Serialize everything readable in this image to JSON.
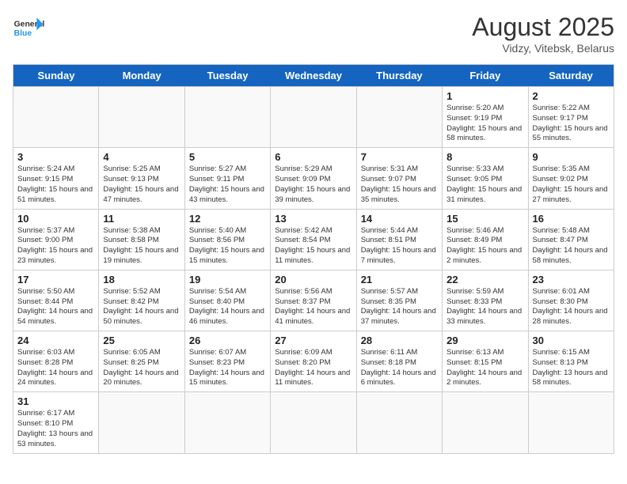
{
  "header": {
    "logo_line1": "General",
    "logo_line2": "Blue",
    "title": "August 2025",
    "subtitle": "Vidzy, Vitebsk, Belarus"
  },
  "days_of_week": [
    "Sunday",
    "Monday",
    "Tuesday",
    "Wednesday",
    "Thursday",
    "Friday",
    "Saturday"
  ],
  "weeks": [
    [
      {
        "date": "",
        "info": ""
      },
      {
        "date": "",
        "info": ""
      },
      {
        "date": "",
        "info": ""
      },
      {
        "date": "",
        "info": ""
      },
      {
        "date": "",
        "info": ""
      },
      {
        "date": "1",
        "info": "Sunrise: 5:20 AM\nSunset: 9:19 PM\nDaylight: 15 hours and 58 minutes."
      },
      {
        "date": "2",
        "info": "Sunrise: 5:22 AM\nSunset: 9:17 PM\nDaylight: 15 hours and 55 minutes."
      }
    ],
    [
      {
        "date": "3",
        "info": "Sunrise: 5:24 AM\nSunset: 9:15 PM\nDaylight: 15 hours and 51 minutes."
      },
      {
        "date": "4",
        "info": "Sunrise: 5:25 AM\nSunset: 9:13 PM\nDaylight: 15 hours and 47 minutes."
      },
      {
        "date": "5",
        "info": "Sunrise: 5:27 AM\nSunset: 9:11 PM\nDaylight: 15 hours and 43 minutes."
      },
      {
        "date": "6",
        "info": "Sunrise: 5:29 AM\nSunset: 9:09 PM\nDaylight: 15 hours and 39 minutes."
      },
      {
        "date": "7",
        "info": "Sunrise: 5:31 AM\nSunset: 9:07 PM\nDaylight: 15 hours and 35 minutes."
      },
      {
        "date": "8",
        "info": "Sunrise: 5:33 AM\nSunset: 9:05 PM\nDaylight: 15 hours and 31 minutes."
      },
      {
        "date": "9",
        "info": "Sunrise: 5:35 AM\nSunset: 9:02 PM\nDaylight: 15 hours and 27 minutes."
      }
    ],
    [
      {
        "date": "10",
        "info": "Sunrise: 5:37 AM\nSunset: 9:00 PM\nDaylight: 15 hours and 23 minutes."
      },
      {
        "date": "11",
        "info": "Sunrise: 5:38 AM\nSunset: 8:58 PM\nDaylight: 15 hours and 19 minutes."
      },
      {
        "date": "12",
        "info": "Sunrise: 5:40 AM\nSunset: 8:56 PM\nDaylight: 15 hours and 15 minutes."
      },
      {
        "date": "13",
        "info": "Sunrise: 5:42 AM\nSunset: 8:54 PM\nDaylight: 15 hours and 11 minutes."
      },
      {
        "date": "14",
        "info": "Sunrise: 5:44 AM\nSunset: 8:51 PM\nDaylight: 15 hours and 7 minutes."
      },
      {
        "date": "15",
        "info": "Sunrise: 5:46 AM\nSunset: 8:49 PM\nDaylight: 15 hours and 2 minutes."
      },
      {
        "date": "16",
        "info": "Sunrise: 5:48 AM\nSunset: 8:47 PM\nDaylight: 14 hours and 58 minutes."
      }
    ],
    [
      {
        "date": "17",
        "info": "Sunrise: 5:50 AM\nSunset: 8:44 PM\nDaylight: 14 hours and 54 minutes."
      },
      {
        "date": "18",
        "info": "Sunrise: 5:52 AM\nSunset: 8:42 PM\nDaylight: 14 hours and 50 minutes."
      },
      {
        "date": "19",
        "info": "Sunrise: 5:54 AM\nSunset: 8:40 PM\nDaylight: 14 hours and 46 minutes."
      },
      {
        "date": "20",
        "info": "Sunrise: 5:56 AM\nSunset: 8:37 PM\nDaylight: 14 hours and 41 minutes."
      },
      {
        "date": "21",
        "info": "Sunrise: 5:57 AM\nSunset: 8:35 PM\nDaylight: 14 hours and 37 minutes."
      },
      {
        "date": "22",
        "info": "Sunrise: 5:59 AM\nSunset: 8:33 PM\nDaylight: 14 hours and 33 minutes."
      },
      {
        "date": "23",
        "info": "Sunrise: 6:01 AM\nSunset: 8:30 PM\nDaylight: 14 hours and 28 minutes."
      }
    ],
    [
      {
        "date": "24",
        "info": "Sunrise: 6:03 AM\nSunset: 8:28 PM\nDaylight: 14 hours and 24 minutes."
      },
      {
        "date": "25",
        "info": "Sunrise: 6:05 AM\nSunset: 8:25 PM\nDaylight: 14 hours and 20 minutes."
      },
      {
        "date": "26",
        "info": "Sunrise: 6:07 AM\nSunset: 8:23 PM\nDaylight: 14 hours and 15 minutes."
      },
      {
        "date": "27",
        "info": "Sunrise: 6:09 AM\nSunset: 8:20 PM\nDaylight: 14 hours and 11 minutes."
      },
      {
        "date": "28",
        "info": "Sunrise: 6:11 AM\nSunset: 8:18 PM\nDaylight: 14 hours and 6 minutes."
      },
      {
        "date": "29",
        "info": "Sunrise: 6:13 AM\nSunset: 8:15 PM\nDaylight: 14 hours and 2 minutes."
      },
      {
        "date": "30",
        "info": "Sunrise: 6:15 AM\nSunset: 8:13 PM\nDaylight: 13 hours and 58 minutes."
      }
    ],
    [
      {
        "date": "31",
        "info": "Sunrise: 6:17 AM\nSunset: 8:10 PM\nDaylight: 13 hours and 53 minutes."
      },
      {
        "date": "",
        "info": ""
      },
      {
        "date": "",
        "info": ""
      },
      {
        "date": "",
        "info": ""
      },
      {
        "date": "",
        "info": ""
      },
      {
        "date": "",
        "info": ""
      },
      {
        "date": "",
        "info": ""
      }
    ]
  ]
}
